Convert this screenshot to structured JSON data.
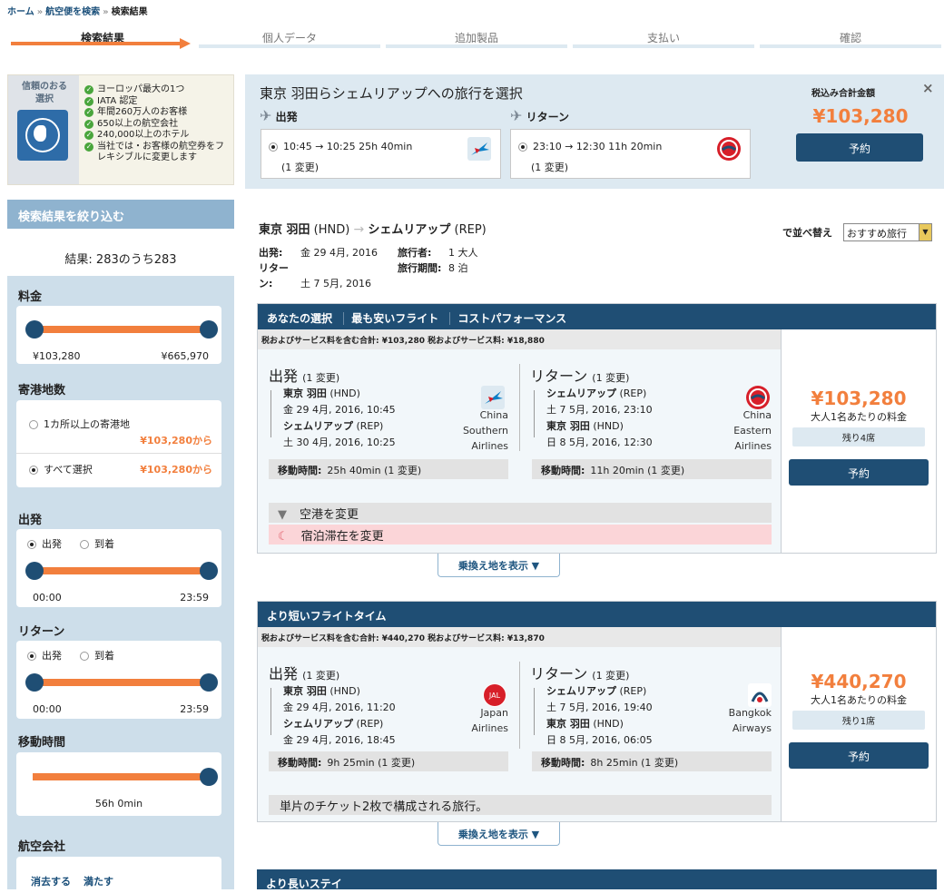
{
  "breadcrumb": {
    "home": "ホーム",
    "search": "航空便を検索",
    "current": "検索結果"
  },
  "steps": [
    "検索結果",
    "個人データ",
    "追加製品",
    "支払い",
    "確認"
  ],
  "trust": {
    "badge": "信頼のおる選択",
    "items": [
      "ヨーロッパ最大の1つ",
      "IATA 認定",
      "年間260万人のお客様",
      "650以上の航空会社",
      "240,000以上のホテル",
      "当社では・お客様の航空券をフレキシブルに変更します"
    ]
  },
  "filter": {
    "title": "検索結果を絞り込む",
    "results": "結果: 283のうち283",
    "price": {
      "label": "料金",
      "min": "¥103,280",
      "max": "¥665,970",
      "low": 0,
      "high": 1
    },
    "stops": {
      "label": "寄港地数",
      "opt1": "1カ所以上の寄港地",
      "opt1_price": "¥103,280から",
      "opt2": "すべて選択",
      "opt2_price": "¥103,280から"
    },
    "depart": {
      "label": "出発",
      "r1": "出発",
      "r2": "到着",
      "min": "00:00",
      "max": "23:59",
      "low": 0,
      "high": 1
    },
    "return": {
      "label": "リターン",
      "r1": "出発",
      "r2": "到着",
      "min": "00:00",
      "max": "23:59",
      "low": 0,
      "high": 1
    },
    "duration": {
      "label": "移動時間",
      "value": "56h 0min",
      "level": 1
    },
    "airlines": {
      "label": "航空会社",
      "clear": "消去する",
      "fill": "満たす"
    }
  },
  "summary": {
    "title": "東京 羽田らシェムリアップへの旅行を選択",
    "depart_label": "出発",
    "return_label": "リターン",
    "depart": {
      "times": "10:45 → 10:25   25h 40min",
      "stops": "(1 変更)"
    },
    "return": {
      "times": "23:10 → 12:30   11h 20min",
      "stops": "(1 変更)"
    },
    "total_label": "税込み合計金額",
    "total": "¥103,280",
    "book": "予約",
    "close": "×"
  },
  "route": {
    "from": "東京 羽田",
    "from_code": "(HND)",
    "to": "シェムリアップ",
    "to_code": "(REP)",
    "depart_k": "出発:",
    "depart_v": "金 29 4月, 2016",
    "return_k": "リターン:",
    "return_v": "土 7 5月, 2016",
    "trav_k": "旅行者:",
    "trav_v": "1 大人",
    "period_k": "旅行期間:",
    "period_v": "8 泊",
    "sort_label": "で並べ替え",
    "sort_value": "おすすめ旅行"
  },
  "cards": [
    {
      "tabs": [
        "あなたの選択",
        "最も安いフライト",
        "コストパフォーマンス"
      ],
      "tax": "税およびサービス料を含む合計: ¥103,280 税およびサービス料: ¥18,880",
      "out": {
        "title": "出発",
        "stops": "(1 変更)",
        "from": "東京 羽田",
        "from_code": "(HND)",
        "from_time": "金 29 4月, 2016, 10:45",
        "to": "シェムリアップ",
        "to_code": "(REP)",
        "to_time": "土 30 4月, 2016, 10:25",
        "airline": [
          "China",
          "Southern",
          "Airlines"
        ],
        "dur_k": "移動時間:",
        "dur_v": "25h 40min (1 変更)"
      },
      "ret": {
        "title": "リターン",
        "stops": "(1 変更)",
        "from": "シェムリアップ",
        "from_code": "(REP)",
        "from_time": "土 7 5月, 2016, 23:10",
        "to": "東京 羽田",
        "to_code": "(HND)",
        "to_time": "日 8 5月, 2016, 12:30",
        "airline": [
          "China",
          "Eastern",
          "Airlines"
        ],
        "dur_k": "移動時間:",
        "dur_v": "11h 20min (1 変更)"
      },
      "notes": [
        "空港を変更",
        "宿泊滞在を変更"
      ],
      "price": "¥103,280",
      "per": "大人1名あたりの料金",
      "seats": "残り4席",
      "book": "予約",
      "show": "乗換え地を表示 ▼"
    },
    {
      "tabs": [
        "より短いフライトタイム"
      ],
      "tax": "税およびサービス料を含む合計: ¥440,270 税およびサービス料: ¥13,870",
      "out": {
        "title": "出発",
        "stops": "(1 変更)",
        "from": "東京 羽田",
        "from_code": "(HND)",
        "from_time": "金 29 4月, 2016, 11:20",
        "to": "シェムリアップ",
        "to_code": "(REP)",
        "to_time": "金 29 4月, 2016, 18:45",
        "airline": [
          "Japan",
          "Airlines"
        ],
        "dur_k": "移動時間:",
        "dur_v": "9h 25min (1 変更)"
      },
      "ret": {
        "title": "リターン",
        "stops": "(1 変更)",
        "from": "シェムリアップ",
        "from_code": "(REP)",
        "from_time": "土 7 5月, 2016, 19:40",
        "to": "東京 羽田",
        "to_code": "(HND)",
        "to_time": "日 8 5月, 2016, 06:05",
        "airline": [
          "Bangkok",
          "Airways"
        ],
        "dur_k": "移動時間:",
        "dur_v": "8h 25min (1 変更)"
      },
      "note": "単片のチケット2枚で構成される旅行。",
      "price": "¥440,270",
      "per": "大人1名あたりの料金",
      "seats": "残り1席",
      "book": "予約",
      "show": "乗換え地を表示 ▼"
    }
  ],
  "card3_title": "より長いステイ"
}
